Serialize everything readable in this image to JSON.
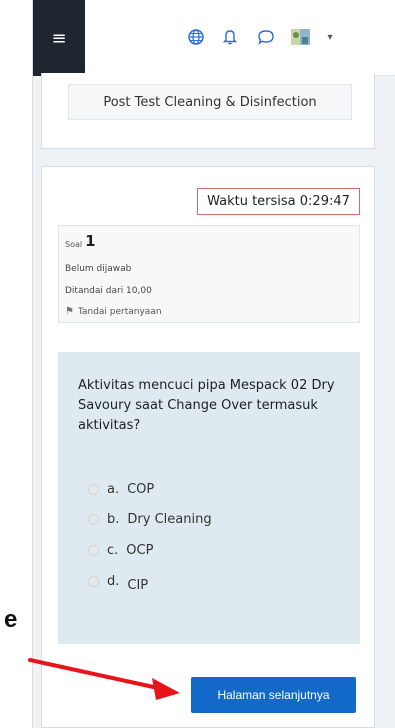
{
  "navbar": {
    "menu_icon": "hamburger-menu-icon",
    "icons": [
      "globe-icon",
      "bell-icon",
      "chat-icon",
      "avatar-icon",
      "caret-down-icon"
    ]
  },
  "quiz": {
    "title": "Post Test Cleaning & Disinfection",
    "timer": "Waktu tersisa 0:29:47"
  },
  "question_info": {
    "label": "Soal",
    "number": "1",
    "status": "Belum dijawab",
    "marks": "Ditandai dari 10,00",
    "flag_label": "Tandai pertanyaan"
  },
  "question": {
    "text": "Aktivitas mencuci pipa Mespack 02 Dry Savoury saat Change Over termasuk aktivitas?",
    "options": [
      {
        "letter": "a.",
        "label": "COP"
      },
      {
        "letter": "b.",
        "label": "Dry Cleaning"
      },
      {
        "letter": "c.",
        "label": "OCP"
      },
      {
        "letter": "d.",
        "label": "CIP"
      }
    ]
  },
  "footer": {
    "next_label": "Halaman selanjutnya"
  },
  "annotation": {
    "letter": "e",
    "color": "#e8141b"
  },
  "colors": {
    "primary": "#1269c7",
    "navbar_dark": "#1f2630",
    "timer_border": "#d96a6a",
    "question_bg": "#deeaef"
  }
}
